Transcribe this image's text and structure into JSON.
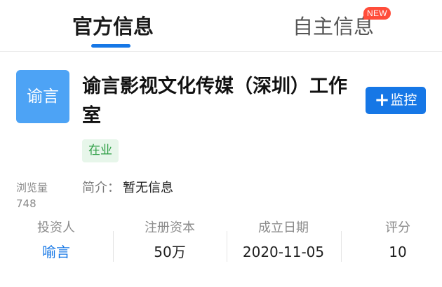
{
  "tabs": {
    "official": "官方信息",
    "own": "自主信息",
    "new_badge": "NEW"
  },
  "company": {
    "logo_text": "谕言",
    "name": "谕言影视文化传媒（深圳）工作室",
    "status": "在业",
    "monitor_label": "监控",
    "monitor_icon": "plus-icon"
  },
  "views": {
    "label": "浏览量",
    "count": "748"
  },
  "intro": {
    "label": "简介：",
    "value": "暂无信息"
  },
  "stats": [
    {
      "label": "投资人",
      "value": "喻言"
    },
    {
      "label": "注册资本",
      "value": "50万"
    },
    {
      "label": "成立日期",
      "value": "2020-11-05"
    },
    {
      "label": "评分",
      "value": "10"
    }
  ],
  "colors": {
    "accent": "#1677e6",
    "logo_bg": "#4da3f5",
    "status_bg": "#e7f6ea",
    "status_text": "#2e9e45",
    "new_badge": "#ff4d3a"
  }
}
